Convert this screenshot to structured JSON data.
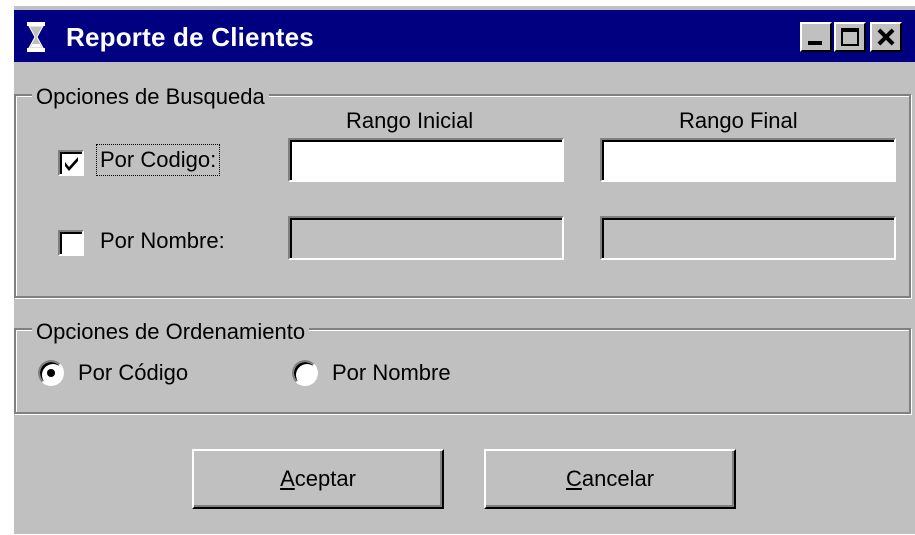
{
  "window": {
    "title": "Reporte de Clientes",
    "title_icon": "hourglass-icon",
    "controls": [
      "minimize-icon",
      "maximize-icon",
      "close-icon"
    ],
    "colors": {
      "titlebar": "#000080",
      "face": "#c0c0c0"
    }
  },
  "search": {
    "legend": "Opciones de Busqueda",
    "col_initial": "Rango Inicial",
    "col_final": "Rango Final",
    "by_code": {
      "label": "Por Codigo:",
      "checked": true,
      "initial_value": "",
      "final_value": ""
    },
    "by_name": {
      "label": "Por Nombre:",
      "checked": false,
      "initial_value": "",
      "final_value": ""
    }
  },
  "order": {
    "legend": "Opciones de Ordenamiento",
    "options": [
      {
        "label": "Por Código",
        "selected": true
      },
      {
        "label": "Por Nombre",
        "selected": false
      }
    ]
  },
  "buttons": {
    "ok": {
      "accel": "A",
      "rest": "ceptar"
    },
    "cancel": {
      "accel": "C",
      "rest": "ancelar"
    }
  }
}
